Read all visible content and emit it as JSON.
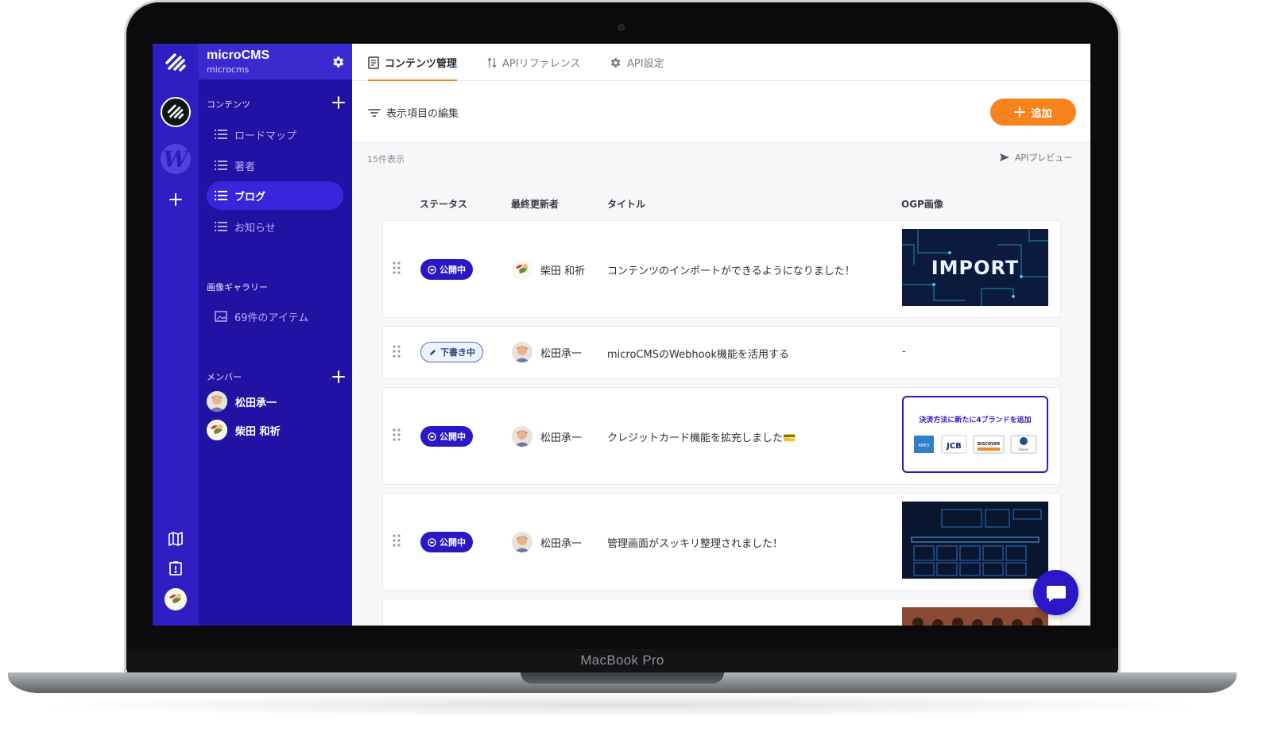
{
  "device": {
    "brand_label": "MacBook Pro"
  },
  "service": {
    "name": "microCMS",
    "id": "microcms"
  },
  "rail": {
    "workspace_letter": "W"
  },
  "sidebar": {
    "content_section": "コンテンツ",
    "content_items": [
      {
        "label": "ロードマップ",
        "active": false
      },
      {
        "label": "著者",
        "active": false
      },
      {
        "label": "ブログ",
        "active": true
      },
      {
        "label": "お知らせ",
        "active": false
      }
    ],
    "gallery_section": "画像ギャラリー",
    "gallery_item": "69件のアイテム",
    "members_section": "メンバー",
    "members": [
      "松田承一",
      "柴田 和祈"
    ]
  },
  "tabs": [
    {
      "label": "コンテンツ管理",
      "icon": "document-icon",
      "active": true
    },
    {
      "label": "APIリファレンス",
      "icon": "arrows-updown-icon",
      "active": false
    },
    {
      "label": "API設定",
      "icon": "gear-icon",
      "active": false
    }
  ],
  "toolbar": {
    "edit_columns": "表示項目の編集",
    "add_button": "追加"
  },
  "list": {
    "count_label": "15件表示",
    "api_preview": "APIプレビュー",
    "headers": {
      "status": "ステータス",
      "author": "最終更新者",
      "title": "タイトル",
      "ogp": "OGP画像"
    },
    "rows": [
      {
        "status": "公開中",
        "status_kind": "published",
        "author": "柴田 和祈",
        "title": "コンテンツのインポートができるようになりました！",
        "ogp": "IMPORT"
      },
      {
        "status": "下書き中",
        "status_kind": "draft",
        "author": "松田承一",
        "title": "microCMSのWebhook機能を活用する",
        "ogp": "-"
      },
      {
        "status": "公開中",
        "status_kind": "published",
        "author": "松田承一",
        "title": "クレジットカード機能を拡充しました💳",
        "ogp": "決済方法に新たに4ブランドを追加",
        "ogp_cards": [
          "AMEX",
          "JCB",
          "DISCOVER",
          "Diners"
        ]
      },
      {
        "status": "公開中",
        "status_kind": "published",
        "author": "松田承一",
        "title": "管理画面がスッキリ整理されました！",
        "ogp": ""
      }
    ]
  },
  "colors": {
    "rail": "#2f1fc2",
    "sidebar": "#2212a4",
    "accent": "#f8831d",
    "published": "#2a18c6"
  }
}
